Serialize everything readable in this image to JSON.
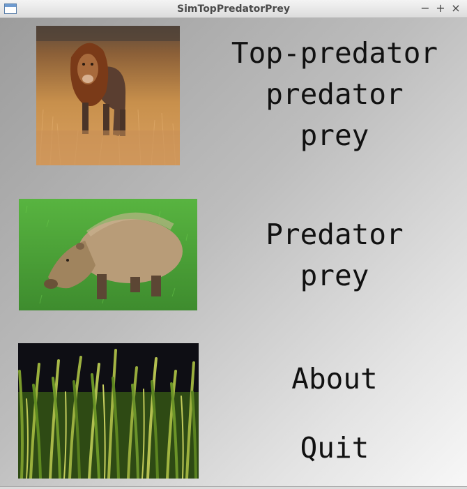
{
  "window": {
    "title": "SimTopPredatorPrey",
    "controls": {
      "minimize": "−",
      "maximize": "+",
      "close": "×"
    }
  },
  "menu": {
    "top_predator": "Top-predator\npredator\nprey",
    "predator_prey": "Predator\nprey",
    "about": "About",
    "quit": "Quit"
  },
  "images": {
    "lion": "lion-photo",
    "capybara": "capybara-photo",
    "grass": "grass-photo"
  }
}
